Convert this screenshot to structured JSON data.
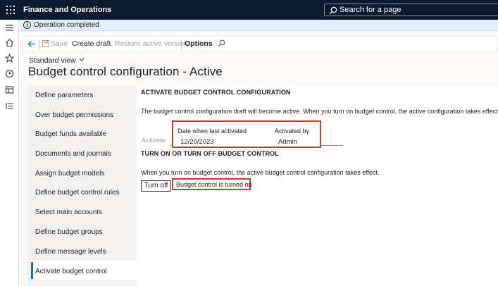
{
  "app": {
    "title": "Finance and Operations",
    "search_placeholder": "Search for a page"
  },
  "message": {
    "text": "Operation completed",
    "icon": "info-icon"
  },
  "toolbar": {
    "save": "Save",
    "create_draft": "Create draft",
    "restore_active": "Restore active version",
    "options": "Options"
  },
  "view": {
    "label": "Standard view"
  },
  "page": {
    "title": "Budget control configuration - Active"
  },
  "nav": {
    "items": [
      "Define parameters",
      "Over budget permissions",
      "Budget funds available",
      "Documents and journals",
      "Assign budget models",
      "Define budget control rules",
      "Select main accounts",
      "Define budget groups",
      "Define message levels",
      "Activate budget control"
    ],
    "active_index": 9
  },
  "activate_section": {
    "heading": "ACTIVATE BUDGET CONTROL CONFIGURATION",
    "description": "The budget control configuration draft will become active. When you turn on budget control, the active configuration takes effect.",
    "activate_button": "Activate",
    "date_label": "Date when last activated",
    "date_value": "12/20/2023",
    "activated_by_label": "Activated by",
    "activated_by_value": "Admin"
  },
  "onoff_section": {
    "heading": "TURN ON OR TURN OFF BUDGET CONTROL",
    "description": "When you turn on budget control, the active budget control configuration takes effect.",
    "turn_off_button": "Turn off",
    "status": "Budget control is turned on"
  },
  "colors": {
    "topbar": "#0b1a2f",
    "highlight": "#d13438",
    "accent": "#0f6cbd",
    "message_bg": "#e1effa"
  }
}
